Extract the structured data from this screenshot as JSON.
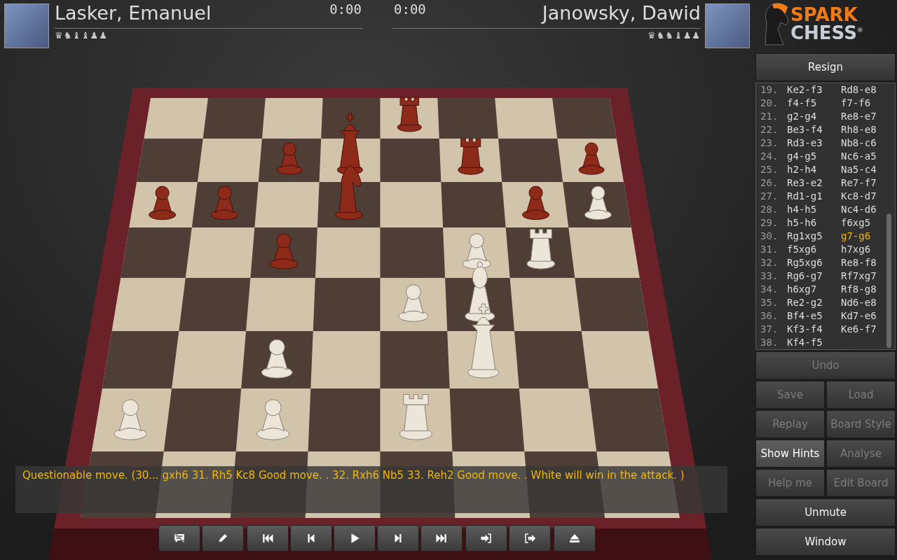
{
  "players": [
    {
      "name": "Lasker, Emanuel",
      "clock": "0:00",
      "captured": "♛♞♝♝♟♟"
    },
    {
      "name": "Janowsky, Dawid",
      "clock": "0:00",
      "captured": "♛♞♞♝♟♟"
    }
  ],
  "logo": {
    "line_1": "SPARK",
    "line_2": "CHESS",
    "mark": "®"
  },
  "commentary": "Questionable move. (30... gxh6 31. Rh5 Kc8 Good move. . 32. Rxh6 Nb5 33. Reh2 Good move. . White will win in the attack. )",
  "resign": {
    "label": "Resign",
    "disabled": false
  },
  "moves": [
    {
      "number": "19.",
      "white": {
        "text": "Ke2-f3",
        "selected": false
      },
      "black": {
        "text": "Rd8-e8",
        "selected": false
      }
    },
    {
      "number": "20.",
      "white": {
        "text": "f4-f5",
        "selected": false
      },
      "black": {
        "text": "f7-f6",
        "selected": false
      }
    },
    {
      "number": "21.",
      "white": {
        "text": "g2-g4",
        "selected": false
      },
      "black": {
        "text": "Re8-e7",
        "selected": false
      }
    },
    {
      "number": "22.",
      "white": {
        "text": "Be3-f4",
        "selected": false
      },
      "black": {
        "text": "Rh8-e8",
        "selected": false
      }
    },
    {
      "number": "23.",
      "white": {
        "text": "Rd3-e3",
        "selected": false
      },
      "black": {
        "text": "Nb8-c6",
        "selected": false
      }
    },
    {
      "number": "24.",
      "white": {
        "text": "g4-g5",
        "selected": false
      },
      "black": {
        "text": "Nc6-a5",
        "selected": false
      }
    },
    {
      "number": "25.",
      "white": {
        "text": "h2-h4",
        "selected": false
      },
      "black": {
        "text": "Na5-c4",
        "selected": false
      }
    },
    {
      "number": "26.",
      "white": {
        "text": "Re3-e2",
        "selected": false
      },
      "black": {
        "text": "Re7-f7",
        "selected": false
      }
    },
    {
      "number": "27.",
      "white": {
        "text": "Rd1-g1",
        "selected": false
      },
      "black": {
        "text": "Kc8-d7",
        "selected": false
      }
    },
    {
      "number": "28.",
      "white": {
        "text": "h4-h5",
        "selected": false
      },
      "black": {
        "text": "Nc4-d6",
        "selected": false
      }
    },
    {
      "number": "29.",
      "white": {
        "text": "h5-h6",
        "selected": false
      },
      "black": {
        "text": "f6xg5",
        "selected": false
      }
    },
    {
      "number": "30.",
      "white": {
        "text": "Rg1xg5",
        "selected": false
      },
      "black": {
        "text": "g7-g6",
        "selected": true
      }
    },
    {
      "number": "31.",
      "white": {
        "text": "f5xg6",
        "selected": false
      },
      "black": {
        "text": "h7xg6",
        "selected": false
      }
    },
    {
      "number": "32.",
      "white": {
        "text": "Rg5xg6",
        "selected": false
      },
      "black": {
        "text": "Re8-f8",
        "selected": false
      }
    },
    {
      "number": "33.",
      "white": {
        "text": "Rg6-g7",
        "selected": false
      },
      "black": {
        "text": "Rf7xg7",
        "selected": false
      }
    },
    {
      "number": "34.",
      "white": {
        "text": "h6xg7",
        "selected": false
      },
      "black": {
        "text": "Rf8-g8",
        "selected": false
      }
    },
    {
      "number": "35.",
      "white": {
        "text": "Re2-g2",
        "selected": false
      },
      "black": {
        "text": "Nd6-e8",
        "selected": false
      }
    },
    {
      "number": "36.",
      "white": {
        "text": "Bf4-e5",
        "selected": false
      },
      "black": {
        "text": "Kd7-e6",
        "selected": false
      }
    },
    {
      "number": "37.",
      "white": {
        "text": "Kf3-f4",
        "selected": false
      },
      "black": {
        "text": "Ke6-f7",
        "selected": false
      }
    },
    {
      "number": "38.",
      "white": {
        "text": "Kf4-f5",
        "selected": false
      }
    }
  ],
  "panel_buttons": [
    {
      "label": "Undo",
      "kind": "wide",
      "disabled": true,
      "on": false
    },
    {
      "label": "Save",
      "kind": "half",
      "disabled": true,
      "on": false
    },
    {
      "label": "Load",
      "kind": "half",
      "disabled": true,
      "on": false
    },
    {
      "label": "Replay",
      "kind": "half",
      "disabled": true,
      "on": false
    },
    {
      "label": "Board Style",
      "kind": "half",
      "disabled": true,
      "on": false
    },
    {
      "label": "Show Hints",
      "kind": "half",
      "disabled": false,
      "on": true
    },
    {
      "label": "Analyse",
      "kind": "half",
      "disabled": true,
      "on": false
    },
    {
      "label": "Help me",
      "kind": "half",
      "disabled": true,
      "on": false
    },
    {
      "label": "Edit Board",
      "kind": "half",
      "disabled": true,
      "on": false
    },
    {
      "label": "Unmute",
      "kind": "wide",
      "disabled": false,
      "on": false
    },
    {
      "label": "Window",
      "kind": "wide",
      "disabled": false,
      "on": false
    }
  ]
}
